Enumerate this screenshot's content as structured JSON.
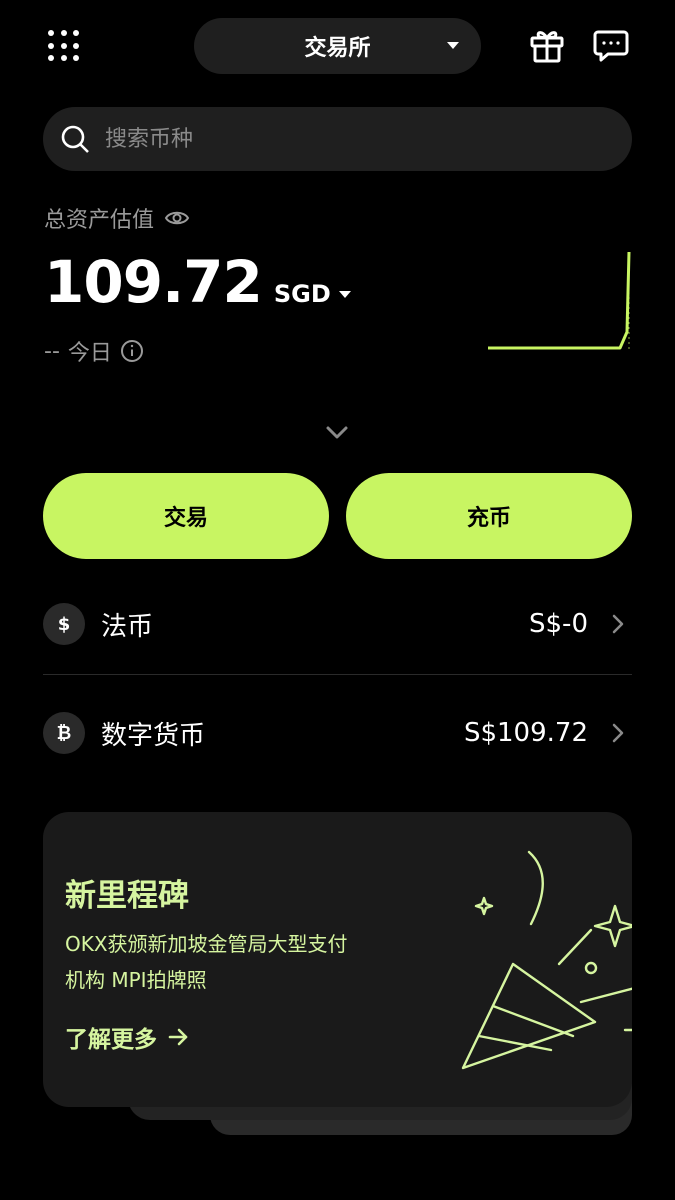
{
  "header": {
    "mode_label": "交易所"
  },
  "search": {
    "placeholder": "搜索币种"
  },
  "assets": {
    "title": "总资产估值",
    "amount": "109.72",
    "currency": "SGD",
    "today_value": "--",
    "today_label": "今日"
  },
  "actions": {
    "trade_label": "交易",
    "deposit_label": "充币"
  },
  "balances": [
    {
      "symbol": "$",
      "name": "法币",
      "value": "S$-0"
    },
    {
      "symbol": "₿",
      "name": "数字货币",
      "value": "S$109.72"
    }
  ],
  "promo": {
    "title": "新里程碑",
    "line1": "OKX获颁新加坡金管局大型支付",
    "line2": "机构 MPI拍牌照",
    "more_label": "了解更多"
  },
  "colors": {
    "accent": "#c8f562",
    "promo_text": "#d6f5a0",
    "background": "#000000",
    "surface": "#1f1f1f"
  }
}
